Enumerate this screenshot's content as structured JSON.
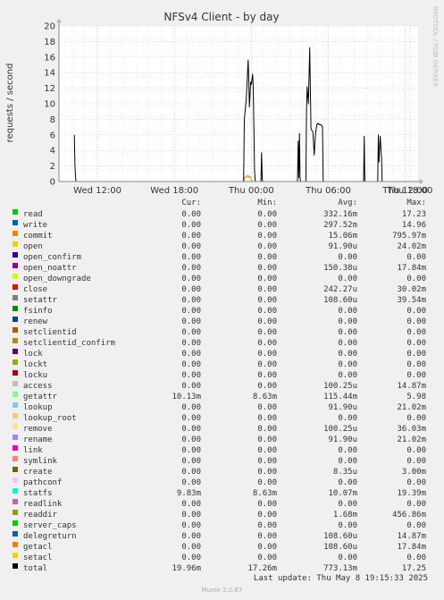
{
  "chart_data": {
    "type": "line",
    "title": "NFSv4 Client - by day",
    "ylabel": "requests / second",
    "side_label": "RRDTOOL / TOBI OETIKER",
    "ylim": [
      0,
      20
    ],
    "yticks": [
      0,
      2,
      4,
      6,
      8,
      10,
      12,
      14,
      16,
      18,
      20
    ],
    "xlim": [
      9,
      37
    ],
    "xticks": [
      {
        "label": "Wed 12:00",
        "hour": 12
      },
      {
        "label": "Wed 18:00",
        "hour": 18
      },
      {
        "label": "Thu 00:00",
        "hour": 24
      },
      {
        "label": "Thu 06:00",
        "hour": 30
      },
      {
        "label": "Thu 12:00",
        "hour": 36
      }
    ],
    "xticks_extra": [
      {
        "label": "Thu 18:00",
        "hour": 42
      }
    ],
    "grid": true,
    "series": [
      {
        "name": "total",
        "color": "#000000",
        "points": [
          [
            10.2,
            6.0
          ],
          [
            10.25,
            2.0
          ],
          [
            10.3,
            0.3
          ],
          [
            10.35,
            0
          ],
          [
            23.4,
            0
          ],
          [
            23.45,
            8.0
          ],
          [
            23.6,
            10.5
          ],
          [
            23.75,
            15.6
          ],
          [
            23.8,
            13.0
          ],
          [
            23.85,
            9.6
          ],
          [
            23.95,
            12.8
          ],
          [
            24.0,
            12.5
          ],
          [
            24.1,
            13.8
          ],
          [
            24.15,
            12.0
          ],
          [
            24.25,
            1.5
          ],
          [
            24.3,
            0
          ],
          [
            24.75,
            0
          ],
          [
            24.8,
            3.7
          ],
          [
            24.85,
            0.2
          ],
          [
            24.9,
            0
          ],
          [
            27.6,
            0
          ],
          [
            27.65,
            5.2
          ],
          [
            27.7,
            0.5
          ],
          [
            27.75,
            6.2
          ],
          [
            27.8,
            0.4
          ],
          [
            27.85,
            0
          ],
          [
            28.25,
            0
          ],
          [
            28.3,
            9.0
          ],
          [
            28.35,
            12.2
          ],
          [
            28.45,
            10.0
          ],
          [
            28.55,
            17.2
          ],
          [
            28.65,
            6.8
          ],
          [
            28.8,
            6.3
          ],
          [
            28.9,
            3.4
          ],
          [
            29.0,
            6.0
          ],
          [
            29.1,
            7.3
          ],
          [
            29.2,
            7.5
          ],
          [
            29.3,
            7.3
          ],
          [
            29.45,
            7.3
          ],
          [
            29.55,
            7.0
          ],
          [
            29.6,
            0
          ],
          [
            32.75,
            0
          ],
          [
            32.8,
            5.8
          ],
          [
            32.85,
            0
          ],
          [
            33.85,
            0
          ],
          [
            33.9,
            6.0
          ],
          [
            33.95,
            2.5
          ],
          [
            34.05,
            5.8
          ],
          [
            34.15,
            3.0
          ],
          [
            34.2,
            0
          ]
        ]
      },
      {
        "name": "commit",
        "color": "#ff8f00",
        "points": [
          [
            23.4,
            0
          ],
          [
            23.5,
            0.6
          ],
          [
            23.6,
            0.5
          ],
          [
            23.7,
            0.8
          ],
          [
            23.8,
            0.5
          ],
          [
            23.9,
            0.7
          ],
          [
            24.0,
            0.2
          ],
          [
            24.1,
            0
          ]
        ]
      }
    ]
  },
  "legend_header": {
    "cur": "Cur:",
    "min": "Min:",
    "avg": "Avg:",
    "max": "Max:"
  },
  "legend": [
    {
      "name": "read",
      "color": "#00cc00",
      "cur": "0.00",
      "min": "0.00",
      "avg": "332.16m",
      "max": "17.23"
    },
    {
      "name": "write",
      "color": "#0066b3",
      "cur": "0.00",
      "min": "0.00",
      "avg": "297.52m",
      "max": "14.96"
    },
    {
      "name": "commit",
      "color": "#ff8000",
      "cur": "0.00",
      "min": "0.00",
      "avg": "15.06m",
      "max": "795.97m"
    },
    {
      "name": "open",
      "color": "#ffcc00",
      "cur": "0.00",
      "min": "0.00",
      "avg": "91.90u",
      "max": "24.02m"
    },
    {
      "name": "open_confirm",
      "color": "#330099",
      "cur": "0.00",
      "min": "0.00",
      "avg": "0.00",
      "max": "0.00"
    },
    {
      "name": "open_noattr",
      "color": "#990099",
      "cur": "0.00",
      "min": "0.00",
      "avg": "150.38u",
      "max": "17.84m"
    },
    {
      "name": "open_downgrade",
      "color": "#ccff00",
      "cur": "0.00",
      "min": "0.00",
      "avg": "0.00",
      "max": "0.00"
    },
    {
      "name": "close",
      "color": "#ff0000",
      "cur": "0.00",
      "min": "0.00",
      "avg": "242.27u",
      "max": "30.02m"
    },
    {
      "name": "setattr",
      "color": "#808080",
      "cur": "0.00",
      "min": "0.00",
      "avg": "108.60u",
      "max": "39.54m"
    },
    {
      "name": "fsinfo",
      "color": "#008f00",
      "cur": "0.00",
      "min": "0.00",
      "avg": "0.00",
      "max": "0.00"
    },
    {
      "name": "renew",
      "color": "#00487d",
      "cur": "0.00",
      "min": "0.00",
      "avg": "0.00",
      "max": "0.00"
    },
    {
      "name": "setclientid",
      "color": "#b35a00",
      "cur": "0.00",
      "min": "0.00",
      "avg": "0.00",
      "max": "0.00"
    },
    {
      "name": "setclientid_confirm",
      "color": "#b38f00",
      "cur": "0.00",
      "min": "0.00",
      "avg": "0.00",
      "max": "0.00"
    },
    {
      "name": "lock",
      "color": "#6b006b",
      "cur": "0.00",
      "min": "0.00",
      "avg": "0.00",
      "max": "0.00"
    },
    {
      "name": "lockt",
      "color": "#8fb300",
      "cur": "0.00",
      "min": "0.00",
      "avg": "0.00",
      "max": "0.00"
    },
    {
      "name": "locku",
      "color": "#b30000",
      "cur": "0.00",
      "min": "0.00",
      "avg": "0.00",
      "max": "0.00"
    },
    {
      "name": "access",
      "color": "#bebebe",
      "cur": "0.00",
      "min": "0.00",
      "avg": "100.25u",
      "max": "14.87m"
    },
    {
      "name": "getattr",
      "color": "#80ff80",
      "cur": "10.13m",
      "min": "8.63m",
      "avg": "115.44m",
      "max": "5.98"
    },
    {
      "name": "lookup",
      "color": "#80c9ff",
      "cur": "0.00",
      "min": "0.00",
      "avg": "91.90u",
      "max": "21.02m"
    },
    {
      "name": "lookup_root",
      "color": "#ffc080",
      "cur": "0.00",
      "min": "0.00",
      "avg": "0.00",
      "max": "0.00"
    },
    {
      "name": "remove",
      "color": "#ffe680",
      "cur": "0.00",
      "min": "0.00",
      "avg": "100.25u",
      "max": "36.03m"
    },
    {
      "name": "rename",
      "color": "#aa80ff",
      "cur": "0.00",
      "min": "0.00",
      "avg": "91.90u",
      "max": "21.02m"
    },
    {
      "name": "link",
      "color": "#ee00cc",
      "cur": "0.00",
      "min": "0.00",
      "avg": "0.00",
      "max": "0.00"
    },
    {
      "name": "symlink",
      "color": "#ff8080",
      "cur": "0.00",
      "min": "0.00",
      "avg": "0.00",
      "max": "0.00"
    },
    {
      "name": "create",
      "color": "#666600",
      "cur": "0.00",
      "min": "0.00",
      "avg": "8.35u",
      "max": "3.00m"
    },
    {
      "name": "pathconf",
      "color": "#ffbfff",
      "cur": "0.00",
      "min": "0.00",
      "avg": "0.00",
      "max": "0.00"
    },
    {
      "name": "statfs",
      "color": "#00ffcc",
      "cur": "9.83m",
      "min": "8.63m",
      "avg": "10.07m",
      "max": "19.39m"
    },
    {
      "name": "readlink",
      "color": "#cc6699",
      "cur": "0.00",
      "min": "0.00",
      "avg": "0.00",
      "max": "0.00"
    },
    {
      "name": "readdir",
      "color": "#999900",
      "cur": "0.00",
      "min": "0.00",
      "avg": "1.68m",
      "max": "456.86m"
    },
    {
      "name": "server_caps",
      "color": "#00cc00",
      "cur": "0.00",
      "min": "0.00",
      "avg": "0.00",
      "max": "0.00"
    },
    {
      "name": "delegreturn",
      "color": "#0066b3",
      "cur": "0.00",
      "min": "0.00",
      "avg": "108.60u",
      "max": "14.87m"
    },
    {
      "name": "getacl",
      "color": "#ff8000",
      "cur": "0.00",
      "min": "0.00",
      "avg": "108.60u",
      "max": "17.84m"
    },
    {
      "name": "setacl",
      "color": "#ffcc00",
      "cur": "0.00",
      "min": "0.00",
      "avg": "0.00",
      "max": "0.00"
    },
    {
      "name": "total",
      "color": "#000000",
      "cur": "19.96m",
      "min": "17.26m",
      "avg": "773.13m",
      "max": "17.25"
    }
  ],
  "last_update": "Last update: Thu May  8 19:15:33 2025",
  "footer": "Munin 2.0.67"
}
